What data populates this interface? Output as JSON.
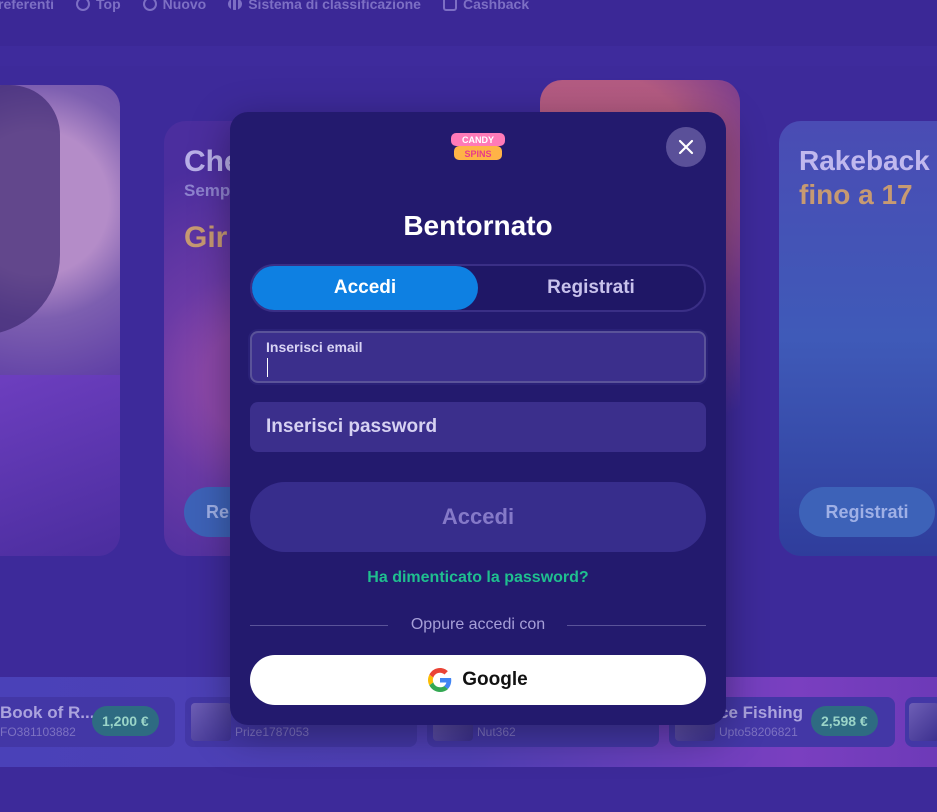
{
  "nav": {
    "items": [
      {
        "label": "referenti",
        "icon": "heart-icon"
      },
      {
        "label": "Top",
        "icon": "circle-icon"
      },
      {
        "label": "Nuovo",
        "icon": "sparkle-icon"
      },
      {
        "label": "Sistema di classificazione",
        "icon": "bars-chart-icon"
      },
      {
        "label": "Cashback",
        "icon": "wallet-icon"
      }
    ]
  },
  "promos": {
    "card2": {
      "title": "Che",
      "subtitle": "Semp",
      "highlight": "Gir",
      "button": "Re"
    },
    "card4": {
      "title": "Rakeback",
      "highlight": "fino a 17",
      "button": "Registrati"
    }
  },
  "winners": [
    {
      "game": "Book of R...",
      "user": "FO381103882",
      "amount": "1,200 €"
    },
    {
      "game": "",
      "user": "Prize1787053",
      "amount": ""
    },
    {
      "game": "",
      "user": "Nut362",
      "amount": ""
    },
    {
      "game": "ce Fishing",
      "user": "Upto58206821",
      "amount": "2,598 €"
    }
  ],
  "modal": {
    "logo": {
      "line1": "CANDY",
      "line2": "SPINS"
    },
    "title": "Bentornato",
    "tabs": [
      {
        "label": "Accedi",
        "active": true
      },
      {
        "label": "Registrati",
        "active": false
      }
    ],
    "email": {
      "label": "Inserisci email",
      "value": ""
    },
    "password": {
      "placeholder": "Inserisci password"
    },
    "submit_label": "Accedi",
    "forgot_label": "Ha dimenticato la password?",
    "or_text": "Oppure accedi con",
    "google_label": "Google"
  },
  "colors": {
    "modal_bg": "#231a6e",
    "tab_active": "#0e80e2",
    "forgot_link": "#1fbf8f",
    "page_bg": "#3d2a9a"
  }
}
